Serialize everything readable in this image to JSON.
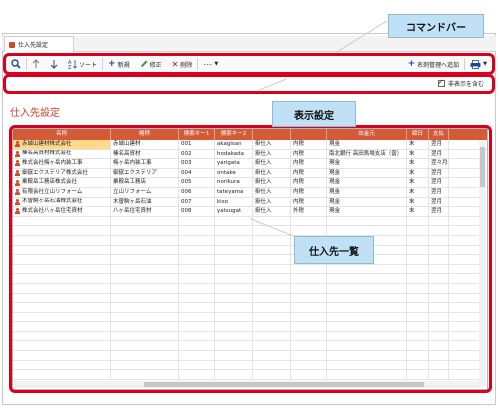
{
  "tab": {
    "label": "仕入先設定"
  },
  "toolbar": {
    "sort_label": "ソート",
    "new_label": "新規",
    "edit_label": "修正",
    "delete_label": "削除",
    "more_label": "･･･",
    "add_to_card_label": "名刺管理へ追加"
  },
  "options": {
    "show_hidden_label": "非表示を含む",
    "show_hidden_checked": true
  },
  "page": {
    "title": "仕入先設定"
  },
  "table": {
    "headers": [
      "名称",
      "略称",
      "検索キー1",
      "検索キー2",
      "",
      "",
      "出金元",
      "締日",
      "支払"
    ],
    "rows": [
      [
        "赤城山建材株式会社",
        "赤城山建材",
        "001",
        "akagisan",
        "掛仕入",
        "内税",
        "現金",
        "末",
        "翌月"
      ],
      [
        "榛名高資材株式会社",
        "榛名高資材",
        "002",
        "hodakada",
        "掛仕入",
        "内税",
        "南北銀行 高田馬場支店（普）",
        "末",
        "翌月"
      ],
      [
        "株式会社梅ヶ岳内装工事",
        "梅ヶ岳内装工事",
        "003",
        "yarigata",
        "掛仕入",
        "内税",
        "現金",
        "末",
        "翌々月"
      ],
      [
        "御嶽エクステリア株式会社",
        "御嶽エクステリア",
        "004",
        "ontake",
        "掛仕入",
        "内税",
        "現金",
        "末",
        "翌月"
      ],
      [
        "乗鞍岳工務店株式会社",
        "乗鞍岳工務店",
        "005",
        "norikura",
        "掛仕入",
        "内税",
        "現金",
        "末",
        "翌月"
      ],
      [
        "有限会社立山リフォーム",
        "立山リフォーム",
        "006",
        "tateyama",
        "掛仕入",
        "内税",
        "現金",
        "末",
        "翌月"
      ],
      [
        "木曽駒ヶ岳石油株式会社",
        "木曽駒ヶ岳石油",
        "007",
        "kiso",
        "掛仕入",
        "内税",
        "現金",
        "末",
        "翌月"
      ],
      [
        "株式会社八ヶ岳住宅資材",
        "八ヶ岳住宅資材",
        "008",
        "yatsugat",
        "掛仕入",
        "外税",
        "現金",
        "末",
        "翌月"
      ]
    ]
  },
  "annotations": {
    "command_bar": "コマンドバー",
    "display_settings": "表示設定",
    "supplier_list": "仕入先一覧"
  },
  "colors": {
    "accent": "#d35b38",
    "highlight": "#d7001f",
    "callout_bg": "#bfe0f5"
  }
}
